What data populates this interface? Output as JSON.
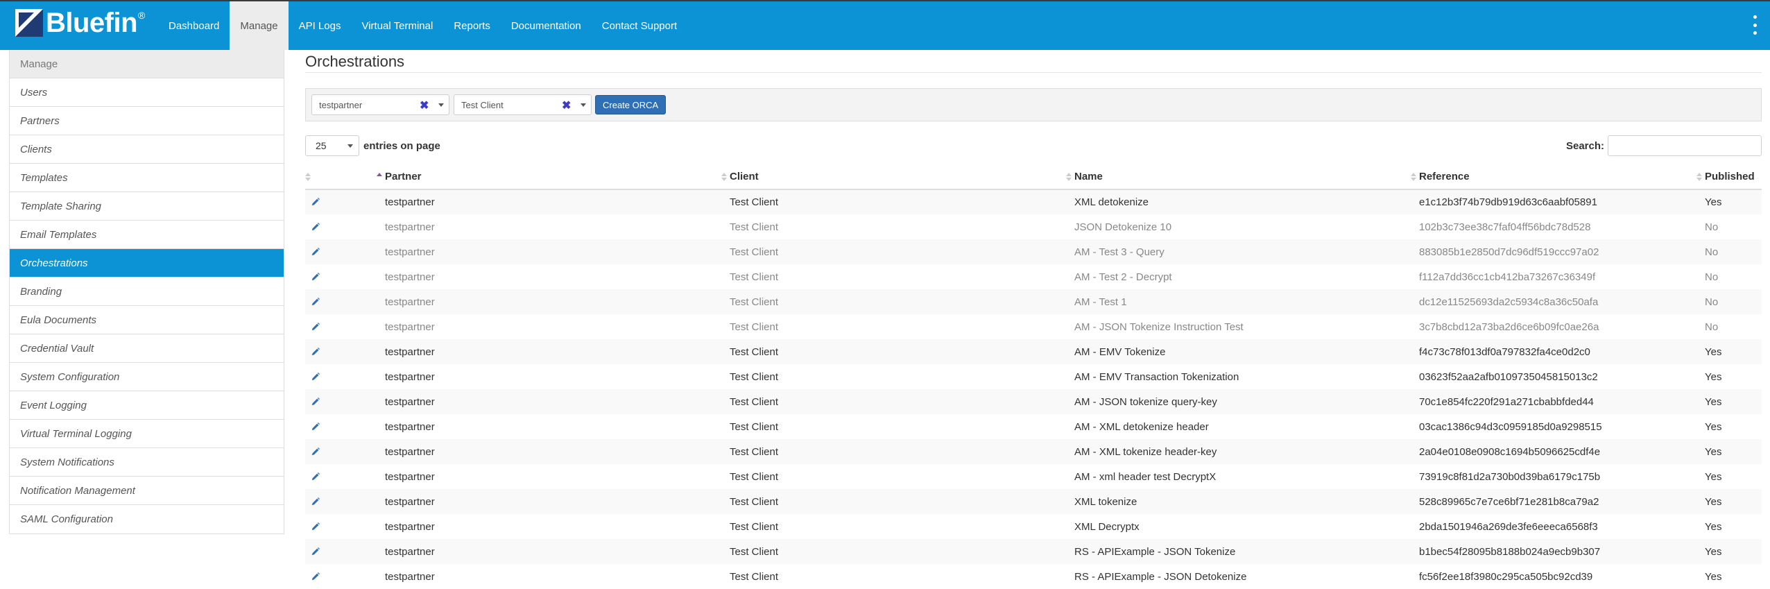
{
  "brand": {
    "name": "Bluefin",
    "reg": "®"
  },
  "nav": {
    "items": [
      "Dashboard",
      "Manage",
      "API Logs",
      "Virtual Terminal",
      "Reports",
      "Documentation",
      "Contact Support"
    ],
    "active": "Manage"
  },
  "sidebar": {
    "header": "Manage",
    "items": [
      "Users",
      "Partners",
      "Clients",
      "Templates",
      "Template Sharing",
      "Email Templates",
      "Orchestrations",
      "Branding",
      "Eula Documents",
      "Credential Vault",
      "System Configuration",
      "Event Logging",
      "Virtual Terminal Logging",
      "System Notifications",
      "Notification Management",
      "SAML Configuration"
    ],
    "active": "Orchestrations"
  },
  "main": {
    "title": "Orchestrations",
    "filters": {
      "partner": "testpartner",
      "client": "Test Client",
      "clear_glyph": "✖",
      "create_label": "Create ORCA"
    },
    "page_size": "25",
    "entries_label": "entries on page",
    "search_label": "Search:",
    "search_value": ""
  },
  "table": {
    "columns": [
      "Partner",
      "Client",
      "Name",
      "Reference",
      "Published"
    ],
    "sorted_column": "Partner",
    "rows": [
      {
        "partner": "testpartner",
        "client": "Test Client",
        "name": "XML detokenize",
        "reference": "e1c12b3f74b79db919d63c6aabf05891",
        "published": "Yes"
      },
      {
        "partner": "testpartner",
        "client": "Test Client",
        "name": "JSON Detokenize 10",
        "reference": "102b3c73ee38c7faf04ff56bdc78d528",
        "published": "No"
      },
      {
        "partner": "testpartner",
        "client": "Test Client",
        "name": "AM - Test 3 - Query",
        "reference": "883085b1e2850d7dc96df519ccc97a02",
        "published": "No"
      },
      {
        "partner": "testpartner",
        "client": "Test Client",
        "name": "AM - Test 2 - Decrypt",
        "reference": "f112a7dd36cc1cb412ba73267c36349f",
        "published": "No"
      },
      {
        "partner": "testpartner",
        "client": "Test Client",
        "name": "AM - Test 1",
        "reference": "dc12e11525693da2c5934c8a36c50afa",
        "published": "No"
      },
      {
        "partner": "testpartner",
        "client": "Test Client",
        "name": "AM - JSON Tokenize Instruction Test",
        "reference": "3c7b8cbd12a73ba2d6ce6b09fc0ae26a",
        "published": "No"
      },
      {
        "partner": "testpartner",
        "client": "Test Client",
        "name": "AM - EMV Tokenize",
        "reference": "f4c73c78f013df0a797832fa4ce0d2c0",
        "published": "Yes"
      },
      {
        "partner": "testpartner",
        "client": "Test Client",
        "name": "AM - EMV Transaction Tokenization",
        "reference": "03623f52aa2afb0109735045815013c2",
        "published": "Yes"
      },
      {
        "partner": "testpartner",
        "client": "Test Client",
        "name": "AM - JSON tokenize query-key",
        "reference": "70c1e854fc220f291a271cbabbfded44",
        "published": "Yes"
      },
      {
        "partner": "testpartner",
        "client": "Test Client",
        "name": "AM - XML detokenize header",
        "reference": "03cac1386c94d3c0959185d0a9298515",
        "published": "Yes"
      },
      {
        "partner": "testpartner",
        "client": "Test Client",
        "name": "AM - XML tokenize header-key",
        "reference": "2a04e0108e0908c1694b5096625cdf4e",
        "published": "Yes"
      },
      {
        "partner": "testpartner",
        "client": "Test Client",
        "name": "AM - xml header test DecryptX",
        "reference": "73919c8f81d2a730b0d39ba6179c175b",
        "published": "Yes"
      },
      {
        "partner": "testpartner",
        "client": "Test Client",
        "name": "XML tokenize",
        "reference": "528c89965c7e7ce6bf71e281b8ca79a2",
        "published": "Yes"
      },
      {
        "partner": "testpartner",
        "client": "Test Client",
        "name": "XML Decryptx",
        "reference": "2bda1501946a269de3fe6eeeca6568f3",
        "published": "Yes"
      },
      {
        "partner": "testpartner",
        "client": "Test Client",
        "name": "RS - APIExample - JSON Tokenize",
        "reference": "b1bec54f28095b8188b024a9ecb9b307",
        "published": "Yes"
      },
      {
        "partner": "testpartner",
        "client": "Test Client",
        "name": "RS - APIExample - JSON Detokenize",
        "reference": "fc56f2ee18f3980c295ca505bc92cd39",
        "published": "Yes"
      }
    ]
  },
  "colors": {
    "primary": "#0b93d6",
    "button": "#2f6fb5",
    "clear_x": "#3b3bc8"
  },
  "icons": {
    "edit": "pencil-icon",
    "menu": "kebab-menu-icon",
    "clear": "clear-x-icon",
    "dropdown": "caret-down-icon"
  }
}
